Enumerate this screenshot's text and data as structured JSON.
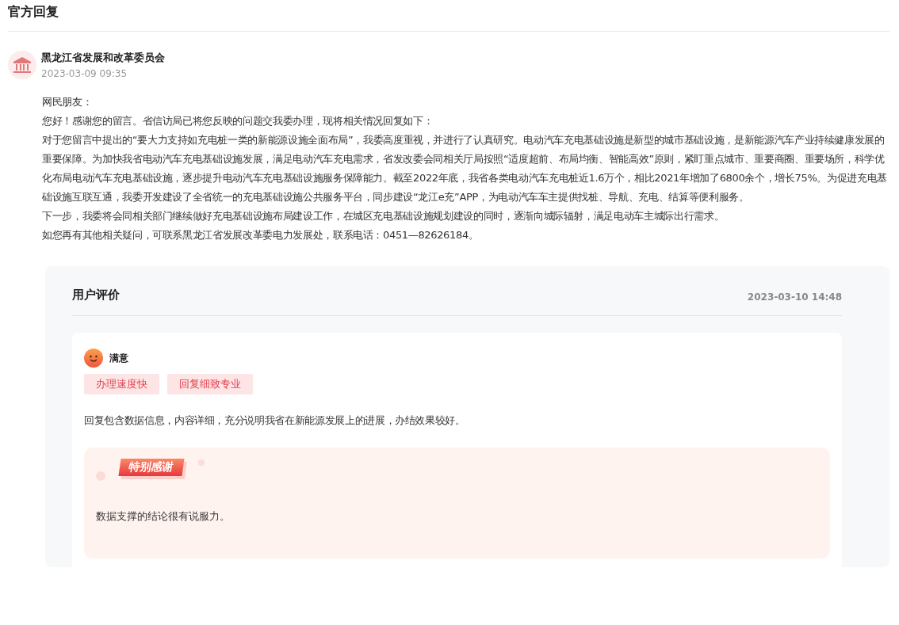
{
  "section_title": "官方回复",
  "reply": {
    "organization": "黑龙江省发展和改革委员会",
    "date": "2023-03-09 09:35",
    "paragraphs": [
      "网民朋友：",
      "您好！感谢您的留言。省信访局已将您反映的问题交我委办理，现将相关情况回复如下：",
      "对于您留言中提出的“要大力支持如充电桩一类的新能源设施全面布局”，我委高度重视，并进行了认真研究。电动汽车充电基础设施是新型的城市基础设施，是新能源汽车产业持续健康发展的重要保障。为加快我省电动汽车充电基础设施发展，满足电动汽车充电需求，省发改委会同相关厅局按照“适度超前、布局均衡、智能高效”原则，紧盯重点城市、重要商圈、重要场所，科学优化布局电动汽车充电基础设施，逐步提升电动汽车充电基础设施服务保障能力。截至2022年底，我省各类电动汽车充电桩近1.6万个，相比2021年增加了6800余个，增长75%。为促进充电基础设施互联互通，我委开发建设了全省统一的充电基础设施公共服务平台，同步建设“龙江e充”APP，为电动汽车车主提供找桩、导航、充电、结算等便利服务。",
      "下一步，我委将会同相关部门继续做好充电基础设施布局建设工作，在城区充电基础设施规划建设的同时，逐渐向城际辐射，满足电动车主城际出行需求。",
      "如您再有其他相关疑问，可联系黑龙江省发展改革委电力发展处，联系电话：0451—82626184。"
    ]
  },
  "evaluation": {
    "title": "用户评价",
    "date": "2023-03-10 14:48",
    "rating": "满意",
    "tags": [
      "办理速度快",
      "回复细致专业"
    ],
    "comment": "回复包含数据信息，内容详细，充分说明我省在新能源发展上的进展，办结效果较好。",
    "thanks": {
      "badge": "特别感谢",
      "text": "数据支撑的结论很有说服力。"
    }
  }
}
